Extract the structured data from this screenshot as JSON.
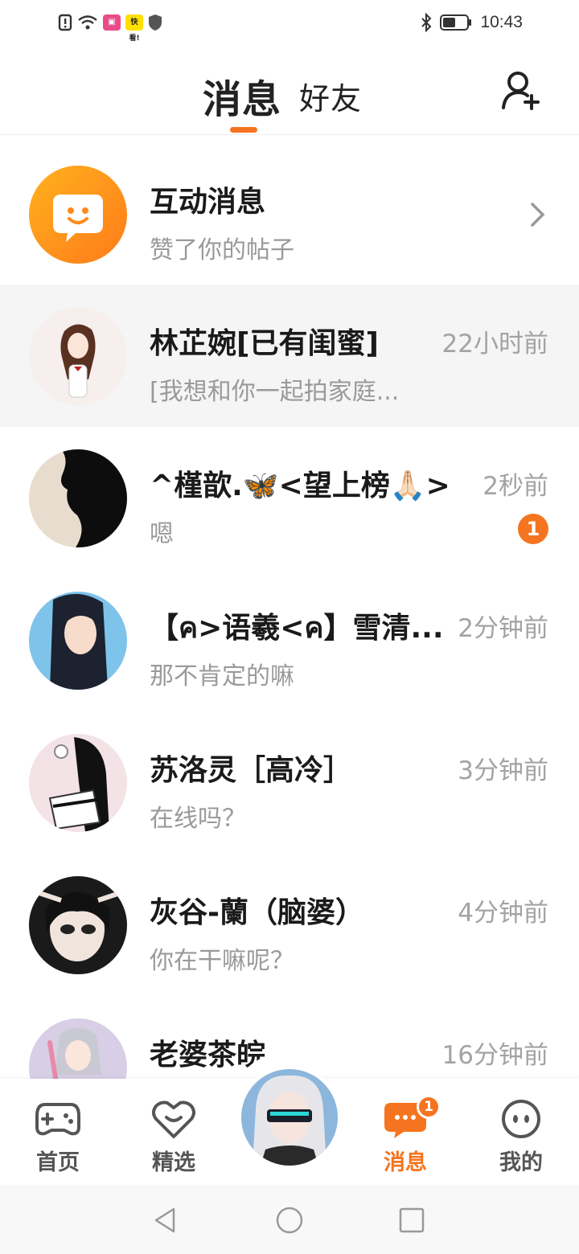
{
  "status_bar": {
    "time": "10:43",
    "icons": [
      "alert-icon",
      "wifi-icon",
      "app-chip-icon",
      "kuaikan-icon",
      "shield-icon",
      "bluetooth-icon",
      "battery-icon"
    ],
    "chip_text": "快看!"
  },
  "header": {
    "tabs": [
      {
        "label": "消息",
        "active": true
      },
      {
        "label": "好友",
        "active": false
      }
    ],
    "add_friend_icon": "add-user-icon",
    "accent": "#f5741f"
  },
  "messages": [
    {
      "type": "system",
      "name": "互动消息",
      "preview": "赞了你的帖子",
      "icon": "chat-bubble-smile-icon"
    },
    {
      "name": "林芷婉[已有闺蜜]",
      "preview": "[我想和你一起拍家庭...",
      "time": "22小时前",
      "highlight": true
    },
    {
      "name": "^槿歆.🦋<望上榜🙏🏻>",
      "preview": "嗯",
      "time": "2秒前",
      "unread": "1"
    },
    {
      "name": "【ค>语羲<ค】雪清...",
      "preview": "那不肯定的嘛",
      "time": "2分钟前"
    },
    {
      "name": "苏洛灵［高冷］",
      "preview": "在线吗？",
      "time": "3分钟前"
    },
    {
      "name": "灰谷-蘭（脑婆）",
      "preview": "你在干嘛呢？",
      "time": "4分钟前"
    },
    {
      "name": "老婆茶皖",
      "preview": "",
      "time": "16分钟前"
    }
  ],
  "bottom_nav": {
    "items": [
      {
        "label": "首页",
        "icon": "gamepad-icon",
        "active": false
      },
      {
        "label": "精选",
        "icon": "heart-chat-icon",
        "active": false
      },
      {
        "label": "消息",
        "icon": "message-icon",
        "active": true,
        "badge": "1"
      },
      {
        "label": "我的",
        "icon": "face-icon",
        "active": false
      }
    ],
    "center_icon": "avatar-center"
  },
  "system_nav": {
    "buttons": [
      "back-icon",
      "home-icon",
      "recents-icon"
    ]
  }
}
